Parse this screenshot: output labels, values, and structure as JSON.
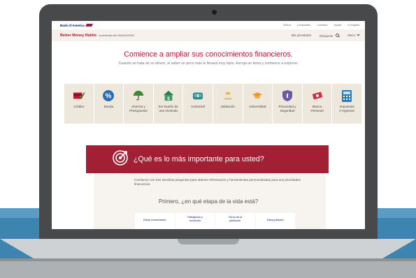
{
  "util_bar": {
    "logo": "Bank of America",
    "links": [
      "Entrar",
      "Localizador",
      "Contacto",
      "Ayuda",
      "In English"
    ]
  },
  "bmh_bar": {
    "title": "Better Money Habits",
    "partner": "in partnership with KHANACADEMY",
    "priorities": "Mis prioridades",
    "search": "Búsqueda",
    "menu": "Menú"
  },
  "hero": {
    "title": "Comience a ampliar sus conocimientos financieros.",
    "subtitle": "Cuando se trata de su dinero, el saber un poco más le llevará muy lejos. Escoja un tema y comience a explorar."
  },
  "topics": [
    {
      "label": "Crédito",
      "icon": "credit-card-icon"
    },
    {
      "label": "Deuda",
      "icon": "percent-icon"
    },
    {
      "label": "Ahorros y\nPresupuesto",
      "icon": "umbrella-icon"
    },
    {
      "label": "Ser Dueño de\nuna Vivienda",
      "icon": "house-icon"
    },
    {
      "label": "Automóvil",
      "icon": "car-icon"
    },
    {
      "label": "Jubilación",
      "icon": "hammock-icon"
    },
    {
      "label": "Universidad",
      "icon": "graduation-cap-icon"
    },
    {
      "label": "Privacidad y\nSeguridad",
      "icon": "shield-icon"
    },
    {
      "label": "Banca\nPersonal",
      "icon": "money-icon"
    },
    {
      "label": "Impuestos\ne Ingresos",
      "icon": "calculator-icon"
    }
  ],
  "priorities": {
    "banner_title": "¿Qué es lo más importante para usted?",
    "intro": "Comience con tres sencillas preguntas para obtener información y herramientas personalizadas para sus prioridades financieras.",
    "question": "Primero, ¿en qué etapa de la vida está?",
    "stages": [
      "Estoy comenzando",
      "Trabajando y\ncreciendo",
      "Cerca de la\njubilación",
      "Estoy jubilado"
    ]
  },
  "colors": {
    "brand_red": "#c41230",
    "banner_red": "#a31f34",
    "tile_bg": "#eee8dc",
    "navy": "#012169"
  }
}
